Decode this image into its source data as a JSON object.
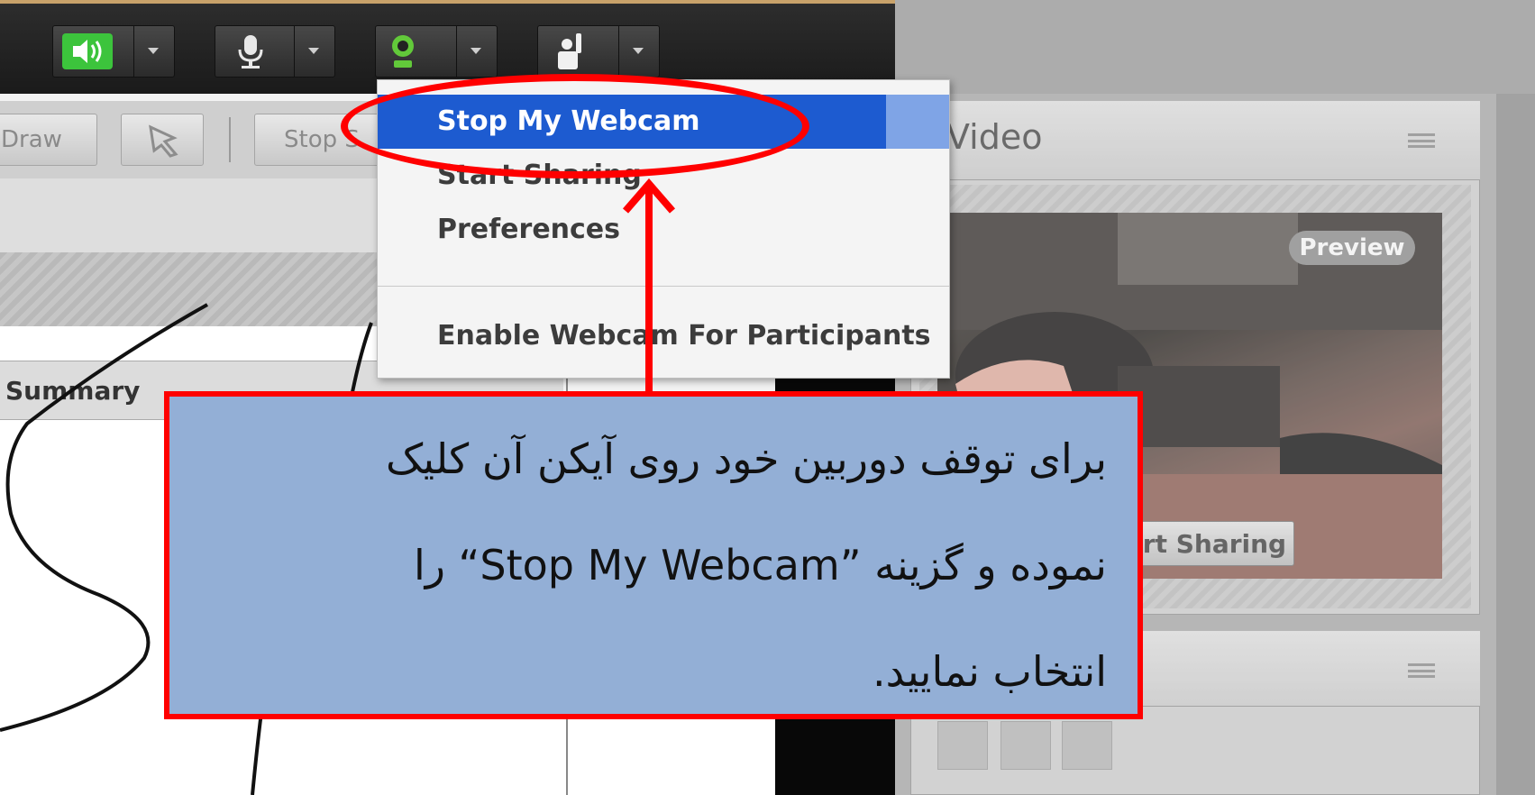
{
  "toolbar": {
    "icons": [
      "speaker-icon",
      "microphone-icon",
      "webcam-icon",
      "raise-hand-icon"
    ]
  },
  "subbar": {
    "draw_label": "Draw",
    "stop_label": "Stop S"
  },
  "left": {
    "summary_label": "Summary"
  },
  "video_pod": {
    "title": "Video",
    "preview_badge": "Preview",
    "start_sharing": "art Sharing"
  },
  "webcam_menu": {
    "items": [
      {
        "label": "Stop My Webcam",
        "selected": true
      },
      {
        "label": "Start Sharing",
        "selected": false
      },
      {
        "label": "Preferences",
        "selected": false
      },
      {
        "label": "Enable Webcam For Participants",
        "selected": false
      }
    ]
  },
  "callout": {
    "line1": "برای توقف دوربین خود روی آیکن آن کلیک",
    "line2": "نموده و گزینه ”Stop My Webcam“ را",
    "line3": "انتخاب نمایید."
  },
  "colors": {
    "accent_red": "#ff0000",
    "callout_bg": "#93afd6",
    "menu_highlight": "#1d5bd0",
    "speaker_green": "#3cc43c"
  }
}
